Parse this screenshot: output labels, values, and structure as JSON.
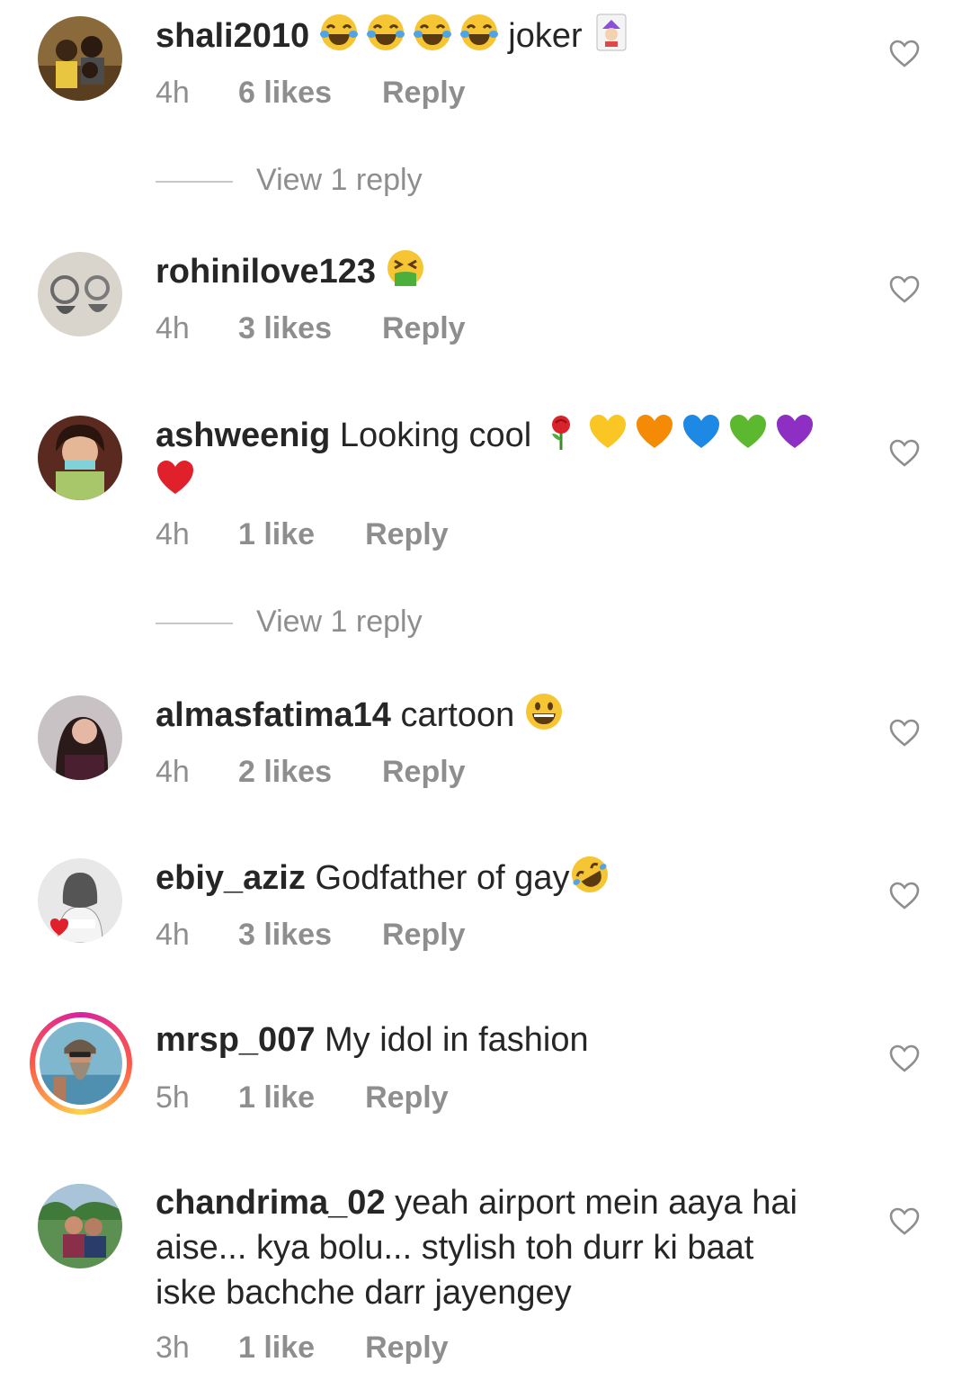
{
  "comments": [
    {
      "username": "shali2010",
      "text": " joker",
      "emojis_before": [
        "tears-of-joy",
        "tears-of-joy",
        "tears-of-joy",
        "tears-of-joy"
      ],
      "emoji_after": "joker-card",
      "time": "4h",
      "likes": "6 likes",
      "reply": "Reply"
    },
    {
      "username": "rohinilove123",
      "text": "",
      "emoji_after": "vomiting-face",
      "time": "4h",
      "likes": "3 likes",
      "reply": "Reply"
    },
    {
      "username": "ashweenig",
      "text": "Looking cool",
      "emojis_after": [
        "rose",
        "yellow-heart",
        "orange-heart",
        "blue-heart",
        "green-heart",
        "purple-heart",
        "red-heart"
      ],
      "time": "4h",
      "likes": "1 like",
      "reply": "Reply"
    },
    {
      "username": "almasfatima14",
      "text": "cartoon",
      "emoji_after": "grinning-face",
      "time": "4h",
      "likes": "2 likes",
      "reply": "Reply"
    },
    {
      "username": "ebiy_aziz",
      "text": "Godfather of gay",
      "emoji_after": "rolling-on-floor-laughing",
      "time": "4h",
      "likes": "3 likes",
      "reply": "Reply"
    },
    {
      "username": "mrsp_007",
      "text": "My idol in fashion",
      "time": "5h",
      "likes": "1 like",
      "reply": "Reply"
    },
    {
      "username": "chandrima_02",
      "text_line1": "yeah airport mein aaya hai",
      "text_line2": "aise... kya bolu... stylish toh durr ki baat",
      "text_line3": "iske bachche darr jayengey",
      "time": "3h",
      "likes": "1 like",
      "reply": "Reply"
    }
  ],
  "view_replies_label": "View 1 reply",
  "colors": {
    "text": "#262626",
    "muted": "#8e8e8e",
    "divider": "#c7c7c7"
  }
}
